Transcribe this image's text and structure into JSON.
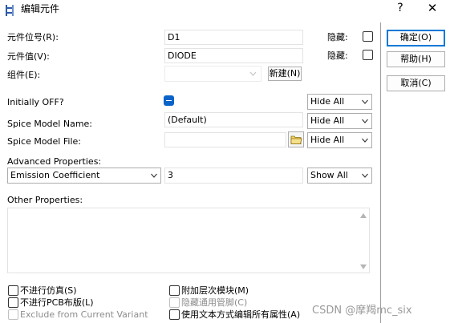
{
  "window": {
    "title": "编辑元件",
    "help_glyph": "?",
    "close_glyph": "✕"
  },
  "fields": {
    "ref_label": "元件位号(R):",
    "ref_value": "D1",
    "value_label": "元件值(V):",
    "value_value": "DIODE",
    "group_label": "组件(E):",
    "group_value": "",
    "hide_label_1": "隐藏:",
    "hide_label_2": "隐藏:",
    "new_button": "新建(N)"
  },
  "buttons": {
    "ok": "确定(O)",
    "help": "帮助(H)",
    "cancel": "取消(C)"
  },
  "props": {
    "initially_off_label": "Initially OFF?",
    "initially_off_visibility": "Hide All",
    "spice_model_name_label": "Spice Model Name:",
    "spice_model_name_value": "(Default)",
    "spice_model_name_visibility": "Hide All",
    "spice_model_file_label": "Spice Model File:",
    "spice_model_file_value": "",
    "spice_model_file_visibility": "Hide All",
    "advanced_label": "Advanced Properties:",
    "advanced_selected": "Emission Coefficient",
    "advanced_value": "3",
    "advanced_visibility": "Show All",
    "other_label": "Other Properties:",
    "other_value": ""
  },
  "options": {
    "no_simulate": "不进行仿真(S)",
    "no_pcb": "不进行PCB布版(L)",
    "exclude_variant": "Exclude from Current Variant",
    "attach_hier": "附加层次模块(M)",
    "hide_common_pins": "隐藏通用管脚(C)",
    "text_edit_all": "使用文本方式编辑所有属性(A)"
  },
  "watermark": "CSDN @摩羯mc_six",
  "colors": {
    "accent": "#0078d7",
    "toggle": "#0a63c9"
  },
  "icons": [
    "app-icon",
    "help-icon",
    "close-icon",
    "chevron-down-icon",
    "folder-icon",
    "scroll-up-icon",
    "scroll-down-icon"
  ]
}
